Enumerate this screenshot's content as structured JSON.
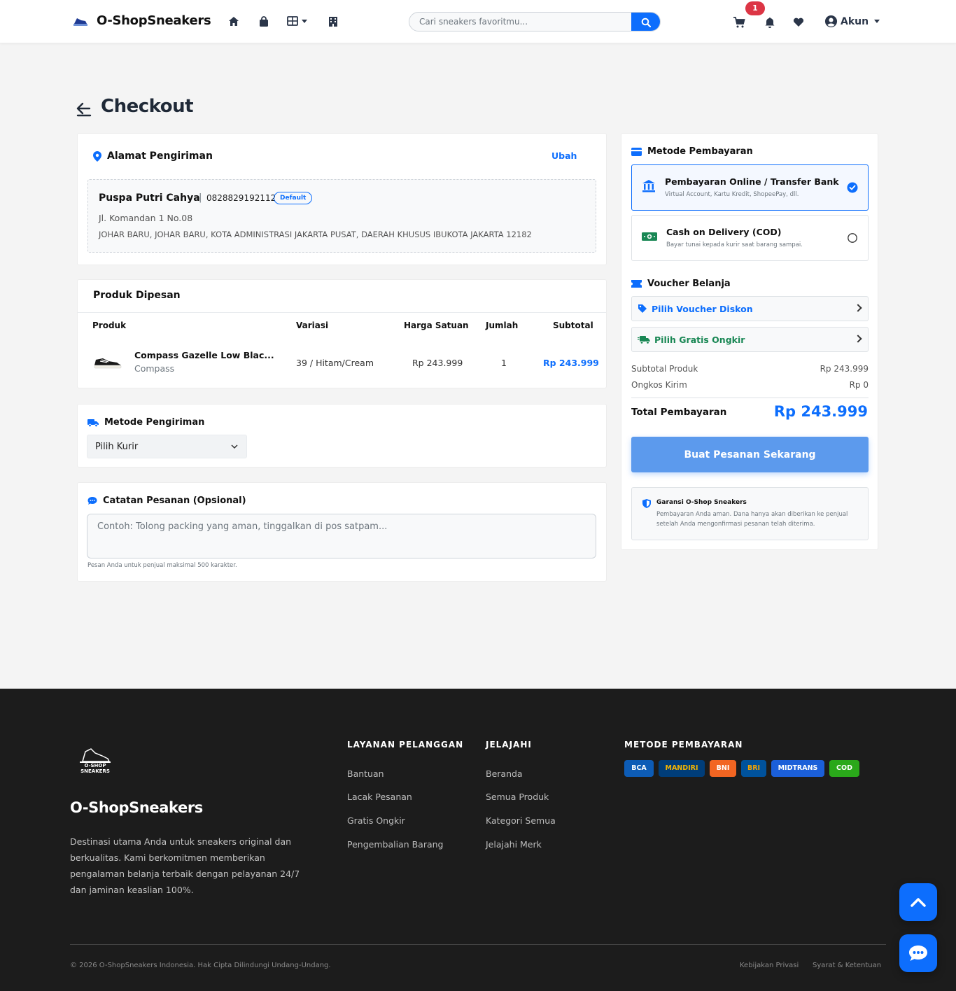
{
  "nav": {
    "brand": "O-ShopSneakers",
    "search_placeholder": "Cari sneakers favoritmu...",
    "cart_count": "1",
    "account_label": "Akun",
    "icons": [
      "home-icon",
      "shopping-bag-icon",
      "grid-icon",
      "building-icon",
      "search-icon",
      "cart-icon",
      "bell-icon",
      "heart-icon",
      "user-circle-icon"
    ]
  },
  "page": {
    "title": "Checkout"
  },
  "address": {
    "title": "Alamat Pengiriman",
    "edit_label": "Ubah",
    "name": "Puspa Putri Cahya",
    "separator": "|",
    "phone": "0828829192112",
    "badge": "Default",
    "street": "Jl. Komandan 1 No.08",
    "region": "JOHAR BARU, JOHAR BARU, KOTA ADMINISTRASI JAKARTA PUSAT, DAERAH KHUSUS IBUKOTA JAKARTA 12182"
  },
  "order": {
    "title": "Produk Dipesan",
    "columns": [
      "Produk",
      "Variasi",
      "Harga Satuan",
      "Jumlah",
      "Subtotal"
    ],
    "items": [
      {
        "name": "Compass Gazelle Low Blac...",
        "brand": "Compass",
        "variant": "39 / Hitam/Cream",
        "price": "Rp 243.999",
        "qty": "1",
        "subtotal": "Rp 243.999"
      }
    ]
  },
  "shipping": {
    "title": "Metode Pengiriman",
    "select_value": "Pilih Kurir"
  },
  "notes": {
    "title": "Catatan Pesanan (Opsional)",
    "placeholder": "Contoh: Tolong packing yang aman, tinggalkan di pos satpam...",
    "hint": "Pesan Anda untuk penjual maksimal 500 karakter."
  },
  "payment": {
    "title": "Metode Pembayaran",
    "options": [
      {
        "title": "Pembayaran Online / Transfer Bank",
        "subtitle": "Virtual Account, Kartu Kredit, ShopeePay, dll.",
        "selected": true
      },
      {
        "title": "Cash on Delivery (COD)",
        "subtitle": "Bayar tunai kepada kurir saat barang sampai.",
        "selected": false
      }
    ]
  },
  "voucher": {
    "title": "Voucher Belanja",
    "discount_label": "Pilih Voucher Diskon",
    "shipping_label": "Pilih Gratis Ongkir"
  },
  "summary": {
    "subtotal_label": "Subtotal Produk",
    "subtotal_value": "Rp 243.999",
    "shipping_label": "Ongkos Kirim",
    "shipping_value": "Rp 0",
    "total_label": "Total Pembayaran",
    "total_value": "Rp 243.999",
    "cta_label": "Buat Pesanan Sekarang"
  },
  "guarantee": {
    "title": "Garansi O-Shop Sneakers",
    "text": "Pembayaran Anda aman. Dana hanya akan diberikan ke penjual setelah Anda mengonfirmasi pesanan telah diterima."
  },
  "footer": {
    "logo_text": "O-SHOP SNEAKERS",
    "brand": "O-ShopSneakers",
    "description": "Destinasi utama Anda untuk sneakers original dan berkualitas. Kami berkomitmen memberikan pengalaman belanja terbaik dengan pelayanan 24/7 dan jaminan keaslian 100%.",
    "service_title": "LAYANAN PELANGGAN",
    "service_links": [
      "Bantuan",
      "Lacak Pesanan",
      "Gratis Ongkir",
      "Pengembalian Barang"
    ],
    "explore_title": "JELAJAHI",
    "explore_links": [
      "Beranda",
      "Semua Produk",
      "Kategori Semua",
      "Jelajahi Merk"
    ],
    "payment_title": "METODE PEMBAYARAN",
    "payment_badges": [
      "BCA",
      "MANDIRI",
      "BNI",
      "BRI",
      "MIDTRANS",
      "COD"
    ],
    "copyright": "© 2026 O-ShopSneakers Indonesia. Hak Cipta Dilindungi Undang-Undang.",
    "privacy": "Kebijakan Privasi",
    "terms": "Syarat & Ketentuan"
  },
  "colors": {
    "primary": "#0d6efd",
    "success": "#198754",
    "footer_bg": "#1c1c1c",
    "page_bg": "#f4f4f4"
  }
}
